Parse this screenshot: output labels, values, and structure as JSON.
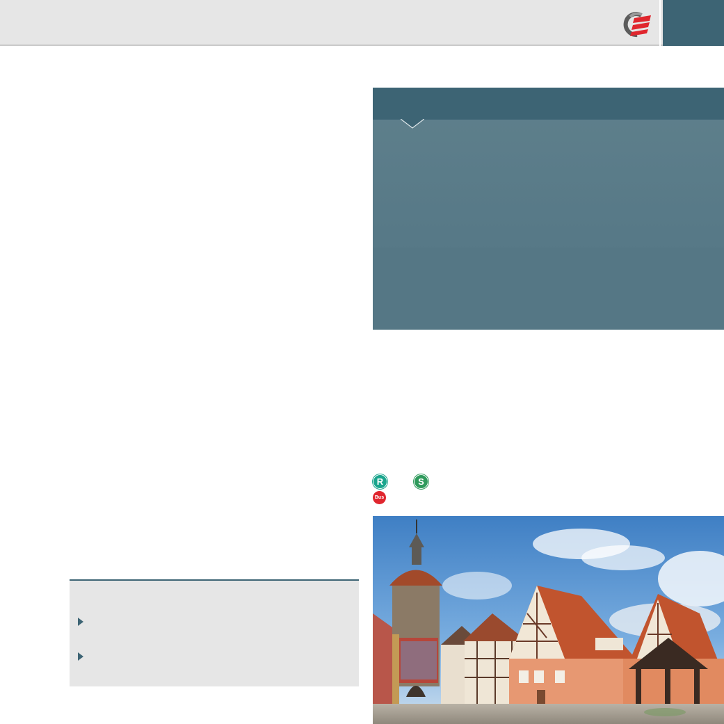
{
  "header": {
    "logo_icon": "company-logo-icon",
    "background_color": "#e6e6e6",
    "tab_color": "#3d6474"
  },
  "info_panel": {
    "head_color": "#3d6474",
    "body_color": "#5f808c"
  },
  "transit": {
    "regional_train": {
      "icon": "regional-train-icon",
      "label": "R",
      "color": "#1aa58d"
    },
    "s_bahn": {
      "icon": "s-bahn-icon",
      "label": "S",
      "color": "#2f9a5c"
    },
    "bus": {
      "icon": "bus-icon",
      "label": "Bus",
      "color": "#e0262e"
    }
  },
  "info_box": {
    "accent_color": "#3d6474",
    "bullet_icon": "triangle-bullet-icon",
    "bullet_count": 2
  },
  "photo": {
    "icon": "town-square-photo"
  }
}
